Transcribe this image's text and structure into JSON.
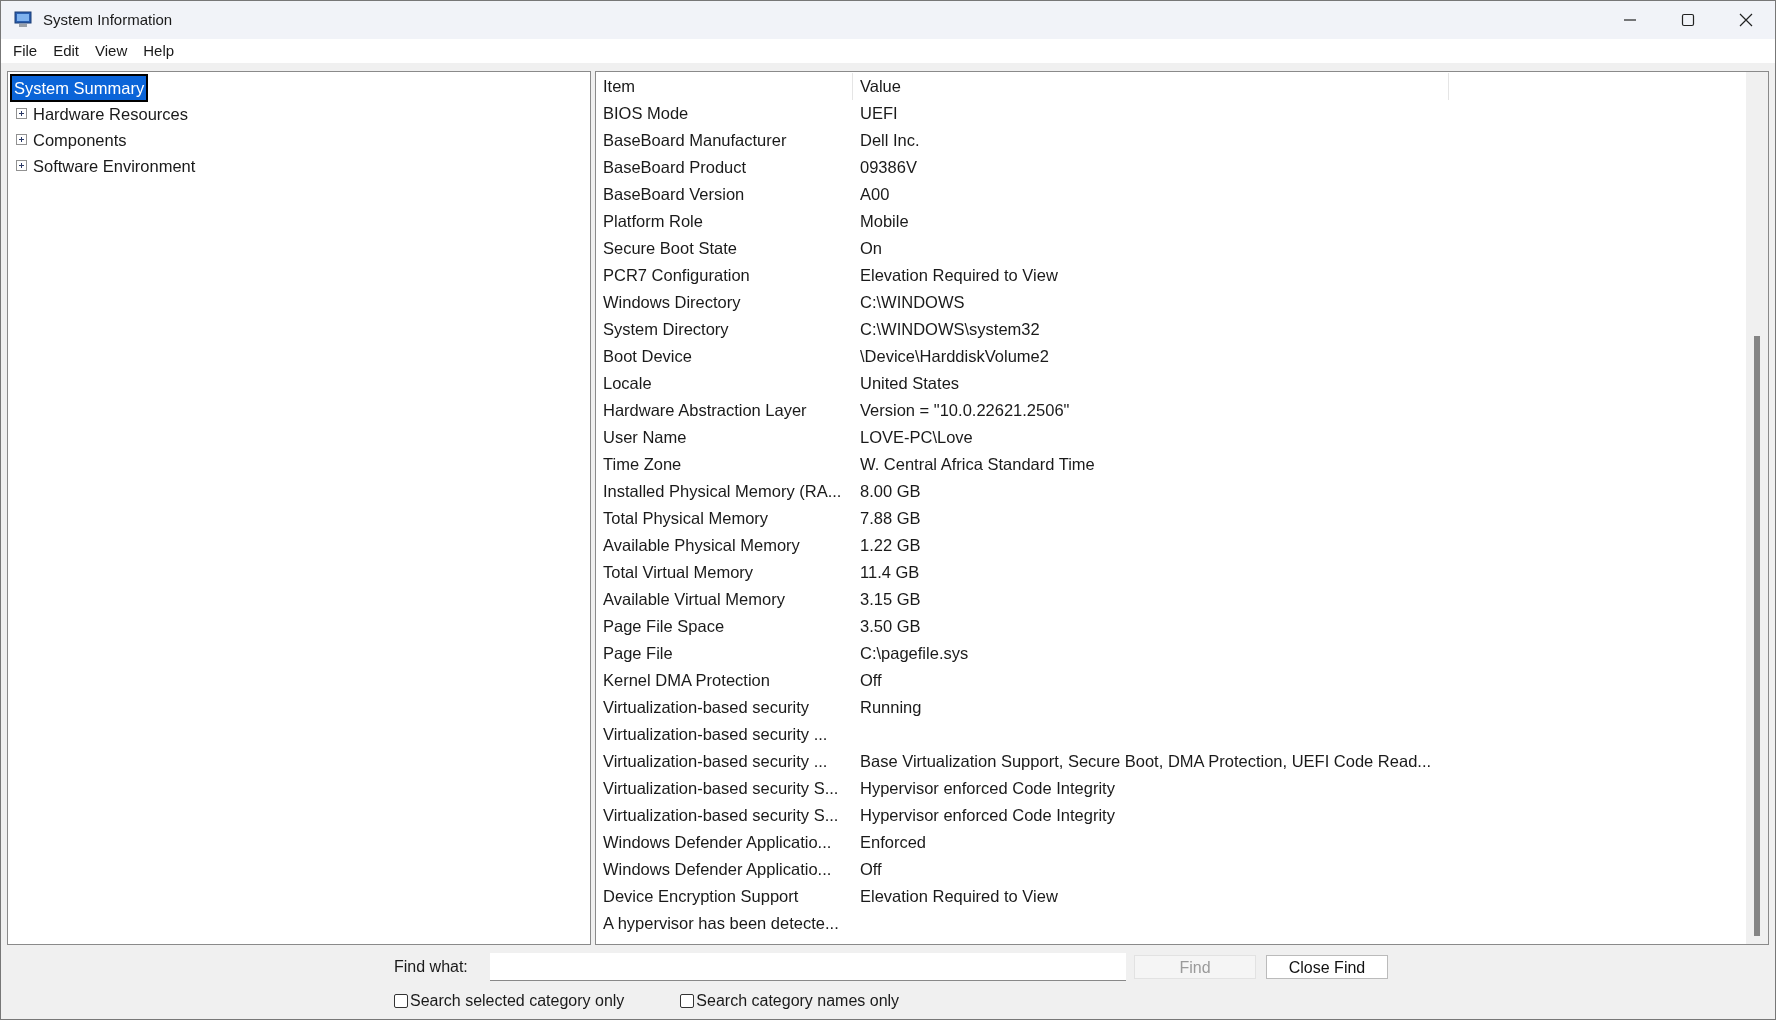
{
  "window": {
    "title": "System Information"
  },
  "menu": [
    "File",
    "Edit",
    "View",
    "Help"
  ],
  "tree": [
    {
      "label": "System Summary",
      "selected": true
    },
    {
      "label": "Hardware Resources",
      "selected": false,
      "expanded": false
    },
    {
      "label": "Components",
      "selected": false,
      "expanded": false
    },
    {
      "label": "Software Environment",
      "selected": false,
      "expanded": false
    }
  ],
  "table": {
    "columns": [
      "Item",
      "Value"
    ],
    "rows": [
      [
        "BIOS Mode",
        "UEFI"
      ],
      [
        "BaseBoard Manufacturer",
        "Dell Inc."
      ],
      [
        "BaseBoard Product",
        "09386V"
      ],
      [
        "BaseBoard Version",
        "A00"
      ],
      [
        "Platform Role",
        "Mobile"
      ],
      [
        "Secure Boot State",
        "On"
      ],
      [
        "PCR7 Configuration",
        "Elevation Required to View"
      ],
      [
        "Windows Directory",
        "C:\\WINDOWS"
      ],
      [
        "System Directory",
        "C:\\WINDOWS\\system32"
      ],
      [
        "Boot Device",
        "\\Device\\HarddiskVolume2"
      ],
      [
        "Locale",
        "United States"
      ],
      [
        "Hardware Abstraction Layer",
        "Version = \"10.0.22621.2506\""
      ],
      [
        "User Name",
        "LOVE-PC\\Love"
      ],
      [
        "Time Zone",
        "W. Central Africa Standard Time"
      ],
      [
        "Installed Physical Memory (RA...",
        "8.00 GB"
      ],
      [
        "Total Physical Memory",
        "7.88 GB"
      ],
      [
        "Available Physical Memory",
        "1.22 GB"
      ],
      [
        "Total Virtual Memory",
        "11.4 GB"
      ],
      [
        "Available Virtual Memory",
        "3.15 GB"
      ],
      [
        "Page File Space",
        "3.50 GB"
      ],
      [
        "Page File",
        "C:\\pagefile.sys"
      ],
      [
        "Kernel DMA Protection",
        "Off"
      ],
      [
        "Virtualization-based security",
        "Running"
      ],
      [
        "Virtualization-based security ...",
        ""
      ],
      [
        "Virtualization-based security ...",
        "Base Virtualization Support, Secure Boot, DMA Protection, UEFI Code Read..."
      ],
      [
        "Virtualization-based security S...",
        "Hypervisor enforced Code Integrity"
      ],
      [
        "Virtualization-based security S...",
        "Hypervisor enforced Code Integrity"
      ],
      [
        "Windows Defender Applicatio...",
        "Enforced"
      ],
      [
        "Windows Defender Applicatio...",
        "Off"
      ],
      [
        "Device Encryption Support",
        "Elevation Required to View"
      ],
      [
        "A hypervisor has been detecte...",
        ""
      ]
    ]
  },
  "find": {
    "label": "Find what:",
    "buttons": [
      {
        "label": "Find",
        "disabled": true
      },
      {
        "label": "Close Find",
        "disabled": false
      }
    ],
    "options": [
      {
        "label": "Search selected category only",
        "checked": false
      },
      {
        "label": "Search category names only",
        "checked": false
      }
    ]
  }
}
